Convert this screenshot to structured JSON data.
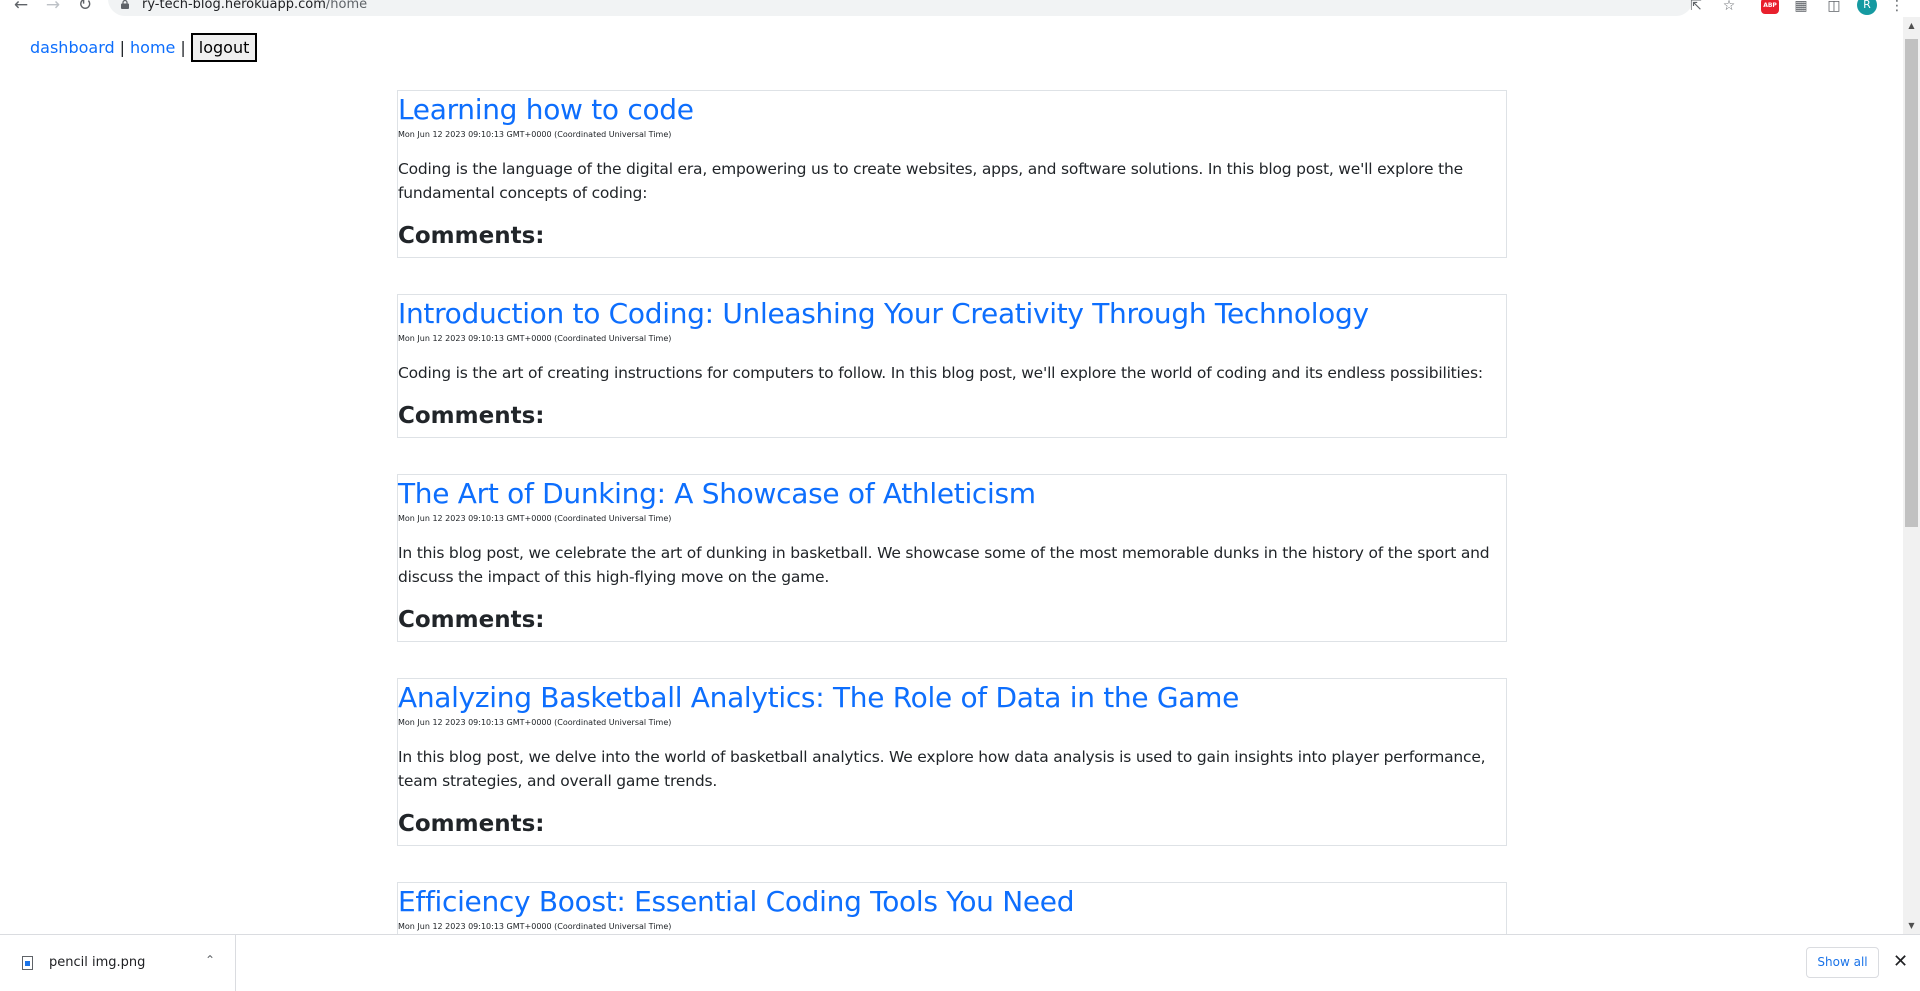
{
  "browser": {
    "url_domain": "ry-tech-blog.herokuapp.com",
    "url_path": "/home",
    "back_icon": "arrow-left-icon",
    "forward_icon": "arrow-right-icon",
    "reload_icon": "reload-icon",
    "abp_label": "ABP",
    "profile_initial": "R"
  },
  "nav": {
    "dashboard": "dashboard",
    "separator": "|",
    "home": "home",
    "logout": "logout"
  },
  "posts": [
    {
      "title": "Learning how to code",
      "date": "Mon Jun 12 2023 09:10:13 GMT+0000 (Coordinated Universal Time)",
      "body": "Coding is the language of the digital era, empowering us to create websites, apps, and software solutions. In this blog post, we'll explore the fundamental concepts of coding:",
      "comments_label": "Comments:"
    },
    {
      "title": "Introduction to Coding: Unleashing Your Creativity Through Technology",
      "date": "Mon Jun 12 2023 09:10:13 GMT+0000 (Coordinated Universal Time)",
      "body": "Coding is the art of creating instructions for computers to follow. In this blog post, we'll explore the world of coding and its endless possibilities:",
      "comments_label": "Comments:"
    },
    {
      "title": "The Art of Dunking: A Showcase of Athleticism",
      "date": "Mon Jun 12 2023 09:10:13 GMT+0000 (Coordinated Universal Time)",
      "body": "In this blog post, we celebrate the art of dunking in basketball. We showcase some of the most memorable dunks in the history of the sport and discuss the impact of this high-flying move on the game.",
      "comments_label": "Comments:"
    },
    {
      "title": "Analyzing Basketball Analytics: The Role of Data in the Game",
      "date": "Mon Jun 12 2023 09:10:13 GMT+0000 (Coordinated Universal Time)",
      "body": "In this blog post, we delve into the world of basketball analytics. We explore how data analysis is used to gain insights into player performance, team strategies, and overall game trends.",
      "comments_label": "Comments:"
    },
    {
      "title": "Efficiency Boost: Essential Coding Tools You Need",
      "date": "Mon Jun 12 2023 09:10:13 GMT+0000 (Coordinated Universal Time)"
    }
  ],
  "download_bar": {
    "file_name": "pencil img.png",
    "show_all": "Show all"
  }
}
